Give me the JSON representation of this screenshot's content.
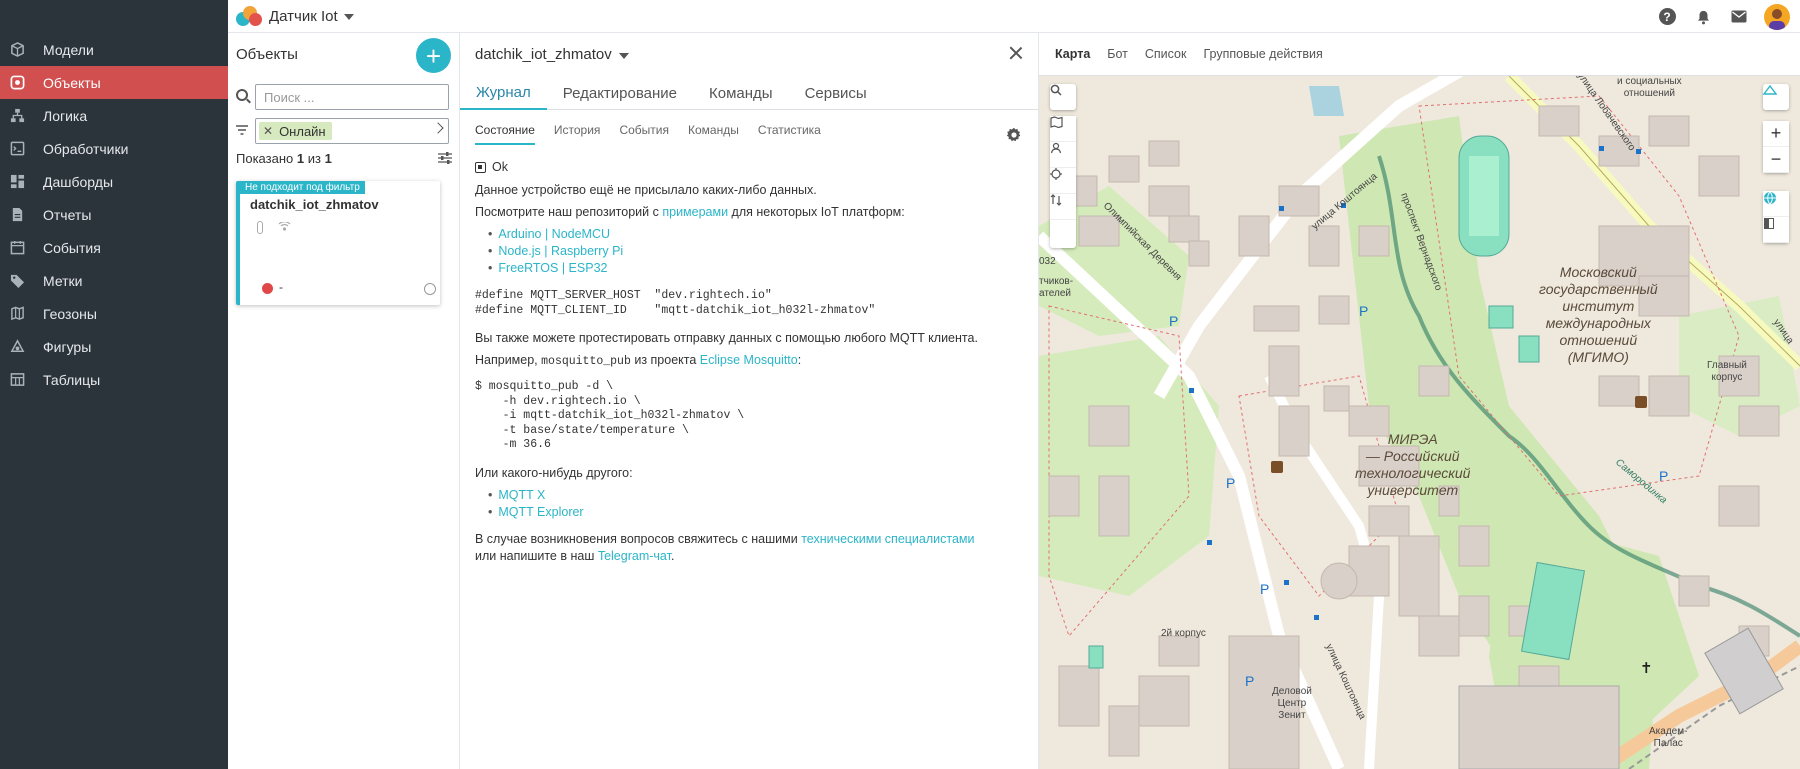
{
  "app": {
    "title": "Датчик Iot"
  },
  "sidebar": {
    "items": [
      {
        "label": "Модели",
        "icon": "cube-icon"
      },
      {
        "label": "Объекты",
        "icon": "object-icon"
      },
      {
        "label": "Логика",
        "icon": "logic-icon"
      },
      {
        "label": "Обработчики",
        "icon": "handler-icon"
      },
      {
        "label": "Дашборды",
        "icon": "dashboard-icon"
      },
      {
        "label": "Отчеты",
        "icon": "report-icon"
      },
      {
        "label": "События",
        "icon": "calendar-icon"
      },
      {
        "label": "Метки",
        "icon": "tag-icon"
      },
      {
        "label": "Геозоны",
        "icon": "geozone-icon"
      },
      {
        "label": "Фигуры",
        "icon": "shape-icon"
      },
      {
        "label": "Таблицы",
        "icon": "table-icon"
      }
    ],
    "active_index": 1
  },
  "objects": {
    "title": "Объекты",
    "add_label": "+",
    "search_placeholder": "Поиск ...",
    "filter_chip": "Онлайн",
    "shown_prefix": "Показано",
    "shown_from": "1",
    "shown_of": "из",
    "shown_total": "1",
    "card": {
      "badge": "Не подходит под фильтр",
      "title": "datchik_iot_zhmatov",
      "status_text": "-",
      "status_color": "#e04848"
    }
  },
  "detail": {
    "title": "datchik_iot_zhmatov",
    "tabs": [
      "Журнал",
      "Редактирование",
      "Команды",
      "Сервисы"
    ],
    "active_tab": 0,
    "subtabs": [
      "Состояние",
      "История",
      "События",
      "Команды",
      "Статистика"
    ],
    "active_subtab": 0,
    "status": "Ok",
    "no_data_text": "Данное устройство ещё не присылало каких-либо данных.",
    "repo_text_1": "Посмотрите наш репозиторий с ",
    "repo_link": "примерами",
    "repo_text_2": " для некоторых IoT платформ:",
    "platforms": [
      "Arduino | NodeMCU",
      "Node.js | Raspberry Pi",
      "FreeRTOS | ESP32"
    ],
    "defines": "#define MQTT_SERVER_HOST  \"dev.rightech.io\"\n#define MQTT_CLIENT_ID    \"mqtt-datchik_iot_h032l-zhmatov\"",
    "test_text": "Вы также можете протестировать отправку данных с помощью любого MQTT клиента.",
    "example_text_1": "Например, ",
    "example_code": "mosquitto_pub",
    "example_text_2": " из проекта ",
    "example_link": "Eclipse Mosquitto",
    "example_text_3": ":",
    "command": "$ mosquitto_pub -d \\\n    -h dev.rightech.io \\\n    -i mqtt-datchik_iot_h032l-zhmatov \\\n    -t base/state/temperature \\\n    -m 36.6",
    "other_text": "Или какого-нибудь другого:",
    "clients": [
      "MQTT X",
      "MQTT Explorer"
    ],
    "contact_text_1": "В случае возникновения вопросов свяжитесь с нашими ",
    "contact_link": "техническими специалистами",
    "contact_text_2": "или напишите в наш ",
    "telegram_link": "Telegram-чат",
    "contact_text_3": "."
  },
  "map": {
    "tabs": [
      "Карта",
      "Бот",
      "Список",
      "Групповые действия"
    ],
    "active_tab": 0,
    "labels": {
      "mgimo": "Московский\nгосударственный\nинститут\nмеждународных\nотношений\n(МГИМО)",
      "mirea": "МИРЭА\n— Российский\nтехнологический\nуниверситет",
      "street1": "улица Коштоянца",
      "street2": "Олимпийская Деревня",
      "street3": "улица Коштоянца",
      "street4": "проспект Вернадского",
      "main_building": "Главный\nкорпус",
      "second_building": "2й корпус",
      "business_center": "Деловой\nЦентр\nЗенит",
      "akadem": "Академ-\nПалас",
      "river": "Самородинка",
      "top_right": "и социальных\nотношений",
      "street_top": "улица Лобачевского",
      "street_right": "улица",
      "left_text": "тчиков-\nателей",
      "num_label": "032"
    },
    "zoom_in": "+",
    "zoom_out": "−"
  }
}
